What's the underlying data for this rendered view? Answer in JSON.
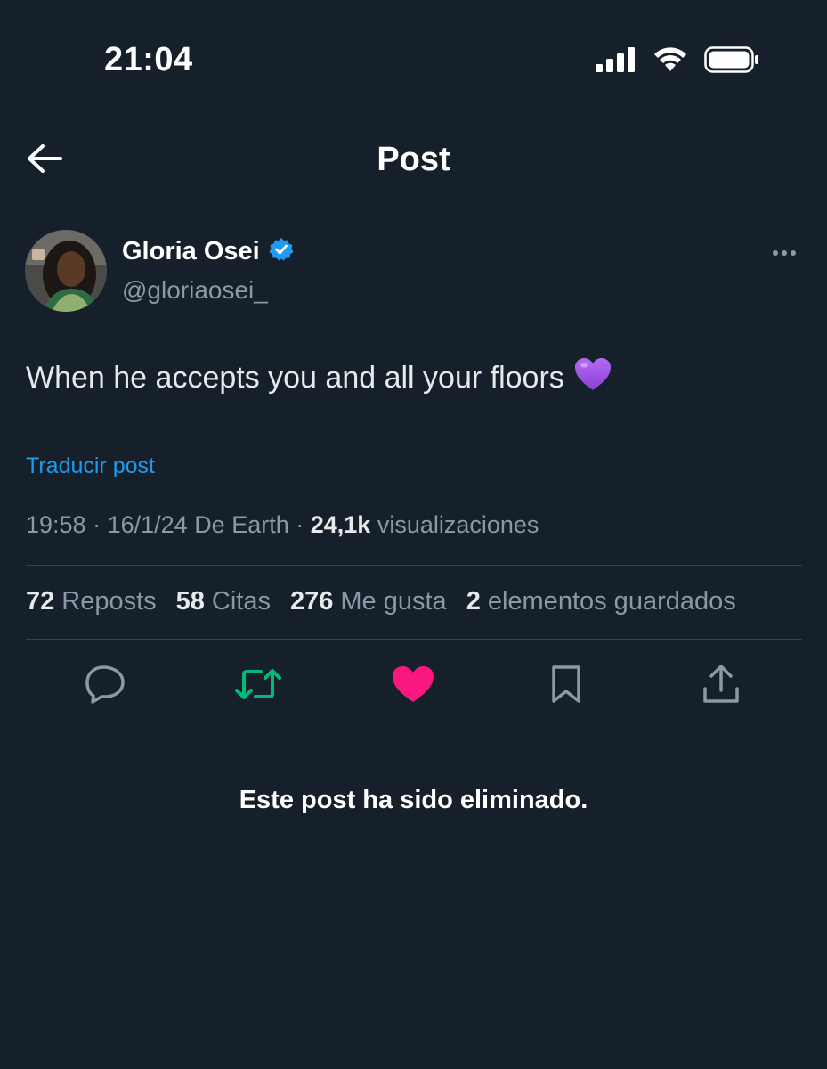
{
  "status_bar": {
    "time": "21:04",
    "signal_icon": "cellular-signal-icon",
    "wifi_icon": "wifi-icon",
    "battery_icon": "battery-icon"
  },
  "header": {
    "back_icon": "back-arrow-icon",
    "title": "Post"
  },
  "author": {
    "name": "Gloria Osei",
    "handle": "@gloriaosei_",
    "verified_icon": "verified-badge-icon",
    "more_icon": "more-options-icon"
  },
  "post": {
    "text": "When he accepts you and all your floors",
    "emoji": "💜",
    "translate_label": "Traducir post",
    "time": "19:58",
    "date": "16/1/24",
    "source": "De Earth",
    "views_count": "24,1k",
    "views_label": "visualizaciones"
  },
  "stats": [
    {
      "count": "72",
      "label": "Reposts"
    },
    {
      "count": "58",
      "label": "Citas"
    },
    {
      "count": "276",
      "label": "Me gusta"
    },
    {
      "count": "2",
      "label": "elementos guardados"
    }
  ],
  "actions": {
    "reply_icon": "reply-icon",
    "repost_icon": "repost-icon",
    "like_icon": "like-heart-icon",
    "bookmark_icon": "bookmark-icon",
    "share_icon": "share-icon"
  },
  "colors": {
    "background": "#15202b",
    "accent": "#1d9bf0",
    "repost_active": "#00ba7c",
    "like_active": "#f91880",
    "secondary_text": "#8b98a5"
  },
  "notice": "Este post ha sido eliminado."
}
